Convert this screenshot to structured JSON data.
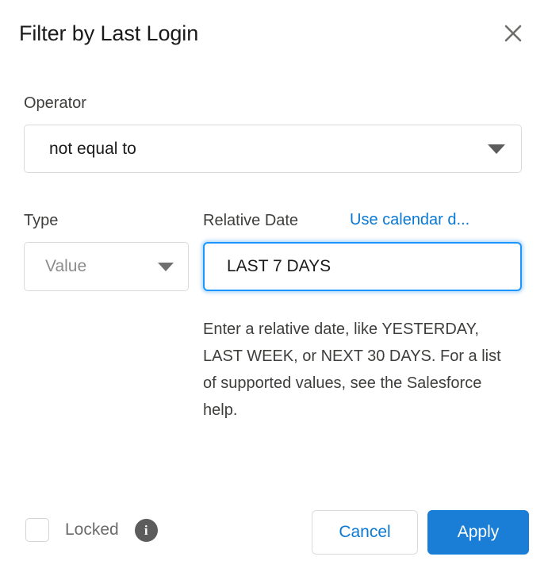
{
  "dialog": {
    "title": "Filter by Last Login",
    "close_icon": "close-icon"
  },
  "operator": {
    "label": "Operator",
    "value": "not equal to",
    "caret_icon": "chevron-down-icon"
  },
  "type": {
    "label": "Type",
    "value": "Value",
    "caret_icon": "chevron-down-icon"
  },
  "relative_date": {
    "label": "Relative Date",
    "calendar_link": "Use calendar d...",
    "value": "LAST 7 DAYS",
    "placeholder": "",
    "help_text": "Enter a relative date, like YESTERDAY, LAST WEEK, or NEXT 30 DAYS. For a list of supported values, see the Salesforce help."
  },
  "footer": {
    "locked_label": "Locked",
    "locked_checked": false,
    "info_icon_glyph": "i",
    "cancel_label": "Cancel",
    "apply_label": "Apply"
  },
  "colors": {
    "accent_blue": "#0a79d4",
    "apply_blue": "#1b7ed6",
    "focus_blue": "#1b96ff",
    "border_grey": "#dddbda",
    "text_dark": "#1a1a1a",
    "text_muted": "#8c8c8c",
    "info_grey": "#5c5c5c"
  }
}
